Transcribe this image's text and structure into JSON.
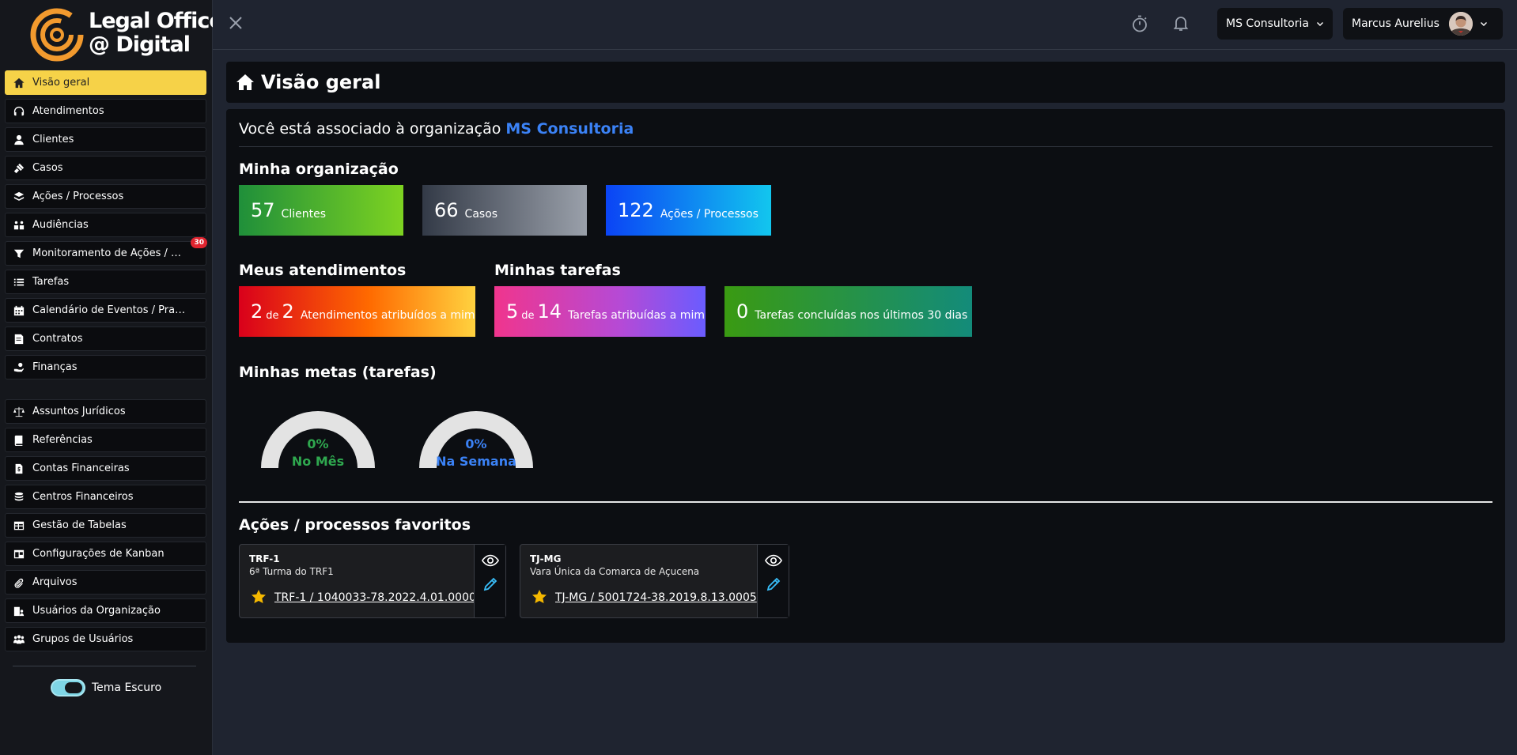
{
  "brand": {
    "line1": "Legal Office",
    "line2": "@ Digital",
    "accent": "#f29a2e"
  },
  "sidebar": {
    "items": [
      {
        "label": "Visão geral",
        "icon": "home-icon",
        "active": true
      },
      {
        "label": "Atendimentos",
        "icon": "headset-icon"
      },
      {
        "label": "Clientes",
        "icon": "user-icon"
      },
      {
        "label": "Casos",
        "icon": "gavel-icon"
      },
      {
        "label": "Ações / Processos",
        "icon": "layers-icon"
      },
      {
        "label": "Audiências",
        "icon": "people-icon"
      },
      {
        "label": "Monitoramento de Ações / Processos",
        "icon": "filter-icon",
        "badge": "30"
      },
      {
        "label": "Tarefas",
        "icon": "list-check-icon"
      },
      {
        "label": "Calendário de Eventos / Prazos",
        "icon": "calendar-icon"
      },
      {
        "label": "Contratos",
        "icon": "contract-icon"
      },
      {
        "label": "Finanças",
        "icon": "hand-coin-icon"
      }
    ],
    "items2": [
      {
        "label": "Assuntos Jurídicos",
        "icon": "scale-icon"
      },
      {
        "label": "Referências",
        "icon": "book-icon"
      },
      {
        "label": "Contas Financeiras",
        "icon": "file-dollar-icon"
      },
      {
        "label": "Centros Financeiros",
        "icon": "coins-icon"
      },
      {
        "label": "Gestão de Tabelas",
        "icon": "table-icon"
      },
      {
        "label": "Configurações de Kanban",
        "icon": "kanban-icon"
      },
      {
        "label": "Arquivos",
        "icon": "paperclip-icon"
      },
      {
        "label": "Usuários da Organização",
        "icon": "users-org-icon"
      },
      {
        "label": "Grupos de Usuários",
        "icon": "users-group-icon"
      }
    ],
    "theme_label": "Tema Escuro",
    "theme_on": true
  },
  "topbar": {
    "org_name": "MS Consultoria",
    "user_name": "Marcus Aurelius"
  },
  "page": {
    "title": "Visão geral",
    "assoc_prefix": "Você está associado à organização",
    "assoc_org": "MS Consultoria"
  },
  "org_section": {
    "title": "Minha organização",
    "stats": [
      {
        "num": "57",
        "label": "Clientes"
      },
      {
        "num": "66",
        "label": "Casos"
      },
      {
        "num": "122",
        "label": "Ações / Processos"
      }
    ]
  },
  "attend_section": {
    "title": "Meus atendimentos",
    "num": "2",
    "of": "de",
    "total": "2",
    "label": "Atendimentos atribuídos a mim"
  },
  "tasks_section": {
    "title": "Minhas tarefas",
    "num": "5",
    "of": "de",
    "total": "14",
    "label": "Tarefas atribuídas a mim",
    "done_num": "0",
    "done_label": "Tarefas concluídas nos últimos 30 dias"
  },
  "goals_section": {
    "title": "Minhas metas (tarefas)",
    "gauges": [
      {
        "value": "0%",
        "label": "No Mês",
        "color": "#2fa84f"
      },
      {
        "value": "0%",
        "label": "Na Semana",
        "color": "#3b82f6"
      }
    ]
  },
  "favorites_section": {
    "title": "Ações / processos favoritos",
    "items": [
      {
        "court": "TRF-1",
        "desc": "6ª Turma do TRF1",
        "link": "TRF-1 / 1040033-78.2022.4.01.0000"
      },
      {
        "court": "TJ-MG",
        "desc": "Vara Única da Comarca de Açucena",
        "link": "TJ-MG / 5001724-38.2019.8.13.0005"
      }
    ]
  }
}
